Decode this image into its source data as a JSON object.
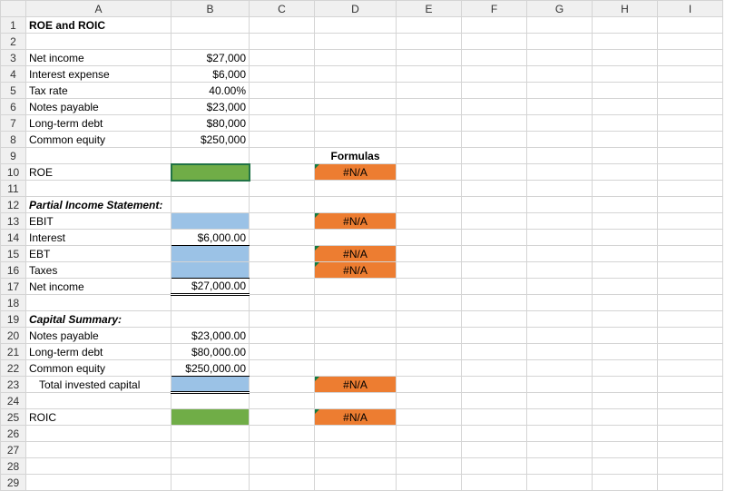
{
  "columns": [
    "A",
    "B",
    "C",
    "D",
    "E",
    "F",
    "G",
    "H",
    "I"
  ],
  "active_cell": "B10",
  "title": "ROE and ROIC",
  "inputs": {
    "net_income": "$27,000",
    "interest_expense": "$6,000",
    "tax_rate": "40.00%",
    "notes_payable": "$23,000",
    "long_term_debt": "$80,000",
    "common_equity": "$250,000"
  },
  "labels": {
    "net_income": "Net income",
    "interest_expense": "Interest expense",
    "tax_rate": "Tax rate",
    "notes_payable": "Notes payable",
    "long_term_debt": "Long-term debt",
    "common_equity": "Common equity",
    "formulas": "Formulas",
    "roe": "ROE",
    "partial_income": "Partial Income Statement:",
    "ebit": "EBIT",
    "interest": "Interest",
    "ebt": "EBT",
    "taxes": "Taxes",
    "net_income2": "Net income",
    "capital_summary": "Capital Summary:",
    "notes_payable2": "Notes payable",
    "long_term_debt2": "Long-term debt",
    "common_equity2": "Common equity",
    "total_invested": "Total invested capital",
    "roic": "ROIC"
  },
  "partial": {
    "interest": "$6,000.00",
    "net_income": "$27,000.00"
  },
  "capital": {
    "notes_payable": "$23,000.00",
    "long_term_debt": "$80,000.00",
    "common_equity": "$250,000.00"
  },
  "na": "#N/A",
  "chart_data": {
    "type": "table",
    "title": "ROE and ROIC",
    "inputs": [
      {
        "label": "Net income",
        "value": 27000
      },
      {
        "label": "Interest expense",
        "value": 6000
      },
      {
        "label": "Tax rate",
        "value": 0.4
      },
      {
        "label": "Notes payable",
        "value": 23000
      },
      {
        "label": "Long-term debt",
        "value": 80000
      },
      {
        "label": "Common equity",
        "value": 250000
      }
    ],
    "roe": null,
    "partial_income_statement": {
      "EBIT": null,
      "Interest": 6000.0,
      "EBT": null,
      "Taxes": null,
      "Net income": 27000.0
    },
    "capital_summary": {
      "Notes payable": 23000.0,
      "Long-term debt": 80000.0,
      "Common equity": 250000.0,
      "Total invested capital": null
    },
    "roic": null,
    "formula_cells": [
      "D10",
      "D13",
      "D15",
      "D16",
      "D23",
      "D25"
    ],
    "formula_value_shown": "#N/A"
  }
}
